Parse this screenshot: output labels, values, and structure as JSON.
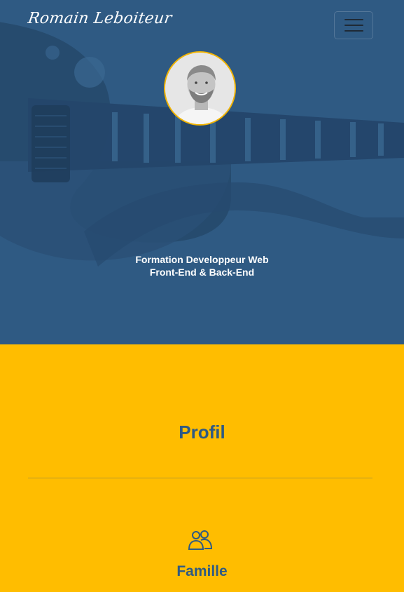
{
  "navbar": {
    "brand": "Romain Leboiteur",
    "toggler_icon": "hamburger-menu-icon"
  },
  "hero": {
    "avatar_icon": "profile-photo",
    "line1": "Formation Developpeur Web",
    "line2": "Front-End & Back-End",
    "background_image": "guitar-silhouette"
  },
  "profil": {
    "title": "Profil",
    "family": {
      "icon": "people-icon",
      "title": "Famille"
    }
  },
  "colors": {
    "hero_bg": "#2f5a83",
    "accent_yellow": "#ffbd00",
    "text_blue": "#2f5a83",
    "avatar_border": "#f2b400"
  }
}
